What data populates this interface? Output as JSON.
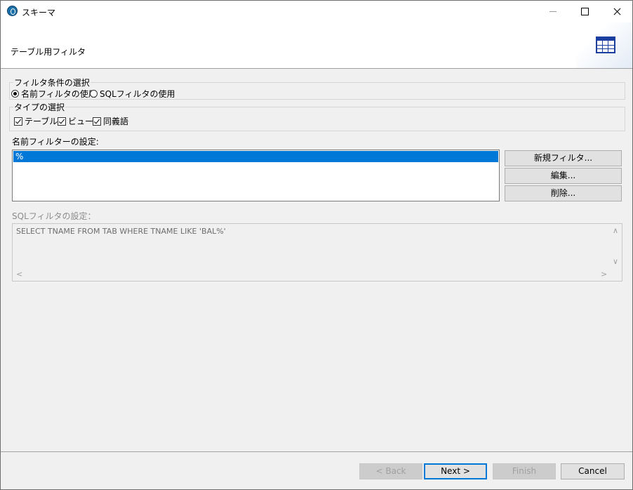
{
  "window": {
    "title": "スキーマ"
  },
  "header": {
    "title": "テーブル用フィルタ",
    "icon": "table-icon"
  },
  "filter_condition": {
    "title": "フィルタ条件の選択",
    "options": [
      {
        "label": "名前フィルタの使用",
        "selected": true
      },
      {
        "label": "SQLフィルタの使用",
        "selected": false
      }
    ]
  },
  "type_selection": {
    "title": "タイプの選択",
    "options": [
      {
        "label": "テーブル",
        "checked": true
      },
      {
        "label": "ビュー",
        "checked": true
      },
      {
        "label": "同義語",
        "checked": true
      }
    ]
  },
  "name_filter": {
    "label": "名前フィルターの設定:",
    "items": [
      "%"
    ],
    "buttons": {
      "new": "新規フィルタ...",
      "edit": "編集...",
      "delete": "削除..."
    }
  },
  "sql_filter": {
    "label": "SQLフィルタの設定：",
    "text": "SELECT TNAME FROM TAB WHERE TNAME LIKE 'BAL%'"
  },
  "footer": {
    "back": "< Back",
    "next": "Next >",
    "finish": "Finish",
    "cancel": "Cancel"
  }
}
